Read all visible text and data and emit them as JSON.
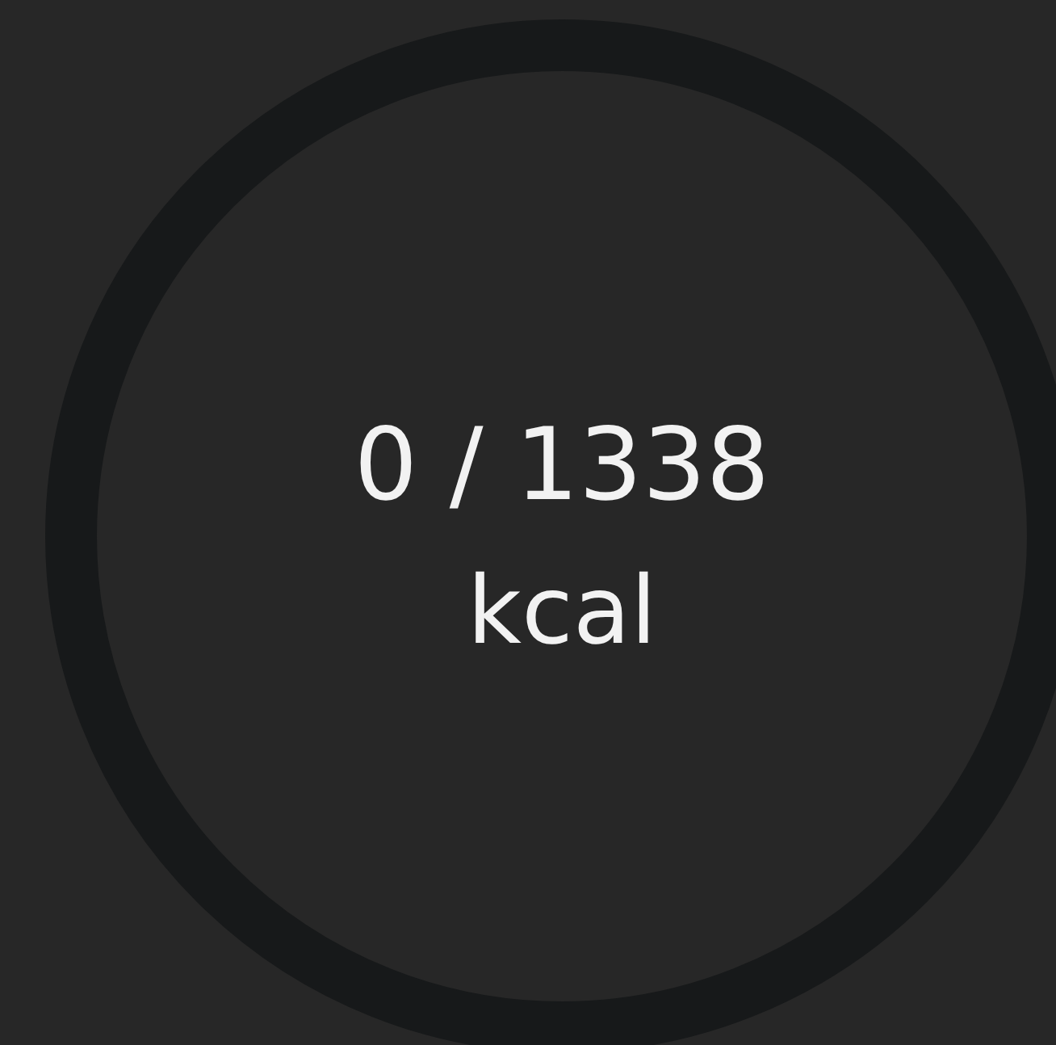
{
  "calorie_ring": {
    "level": 0,
    "consumed": "0 / 1338",
    "unit": "kcal"
  }
}
